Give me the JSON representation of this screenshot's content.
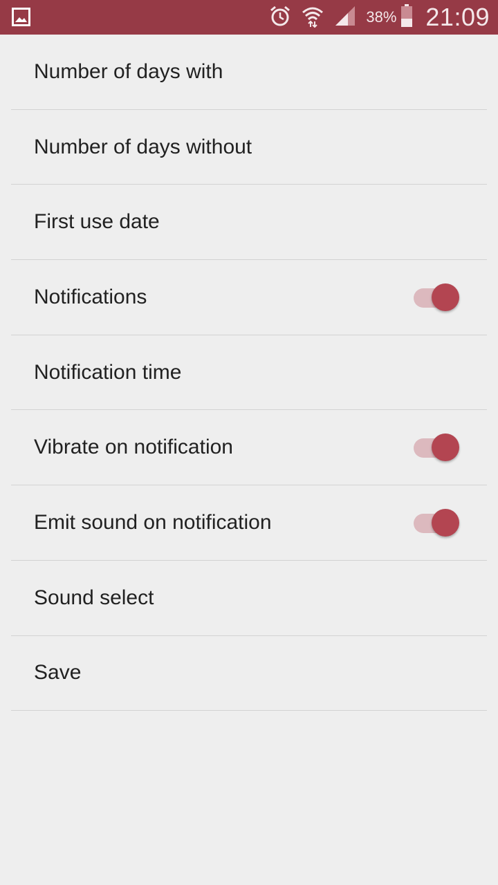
{
  "status_bar": {
    "battery_percent": "38%",
    "time": "21:09",
    "icons": [
      "gallery-icon",
      "alarm-icon",
      "wifi-icon",
      "signal-icon",
      "battery-icon"
    ],
    "background_color": "#963a46"
  },
  "settings": {
    "items": [
      {
        "label": "Number of days with"
      },
      {
        "label": "Number of days without"
      },
      {
        "label": "First use date"
      },
      {
        "label": "Notifications",
        "toggle_on": true
      },
      {
        "label": "Notification time"
      },
      {
        "label": "Vibrate on notification",
        "toggle_on": true
      },
      {
        "label": "Emit sound on notification",
        "toggle_on": true
      },
      {
        "label": "Sound select"
      },
      {
        "label": "Save"
      }
    ]
  },
  "colors": {
    "accent": "#b34551",
    "toggle_track_on": "#dcb9be",
    "background": "#eeeeee",
    "divider": "#d2d2d2",
    "text": "#212121"
  }
}
